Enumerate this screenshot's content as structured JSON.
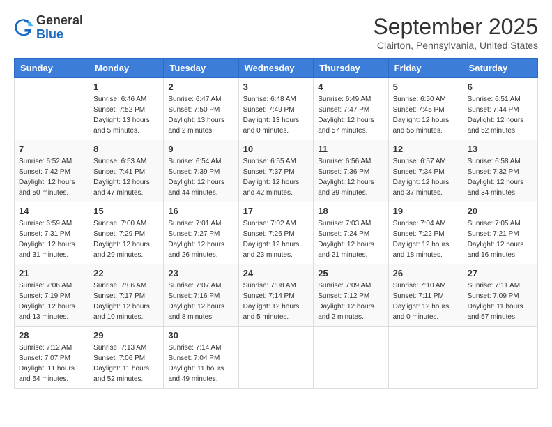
{
  "header": {
    "logo": {
      "general": "General",
      "blue": "Blue"
    },
    "title": "September 2025",
    "location": "Clairton, Pennsylvania, United States"
  },
  "days_of_week": [
    "Sunday",
    "Monday",
    "Tuesday",
    "Wednesday",
    "Thursday",
    "Friday",
    "Saturday"
  ],
  "weeks": [
    [
      {
        "day": "",
        "info": ""
      },
      {
        "day": "1",
        "info": "Sunrise: 6:46 AM\nSunset: 7:52 PM\nDaylight: 13 hours\nand 5 minutes."
      },
      {
        "day": "2",
        "info": "Sunrise: 6:47 AM\nSunset: 7:50 PM\nDaylight: 13 hours\nand 2 minutes."
      },
      {
        "day": "3",
        "info": "Sunrise: 6:48 AM\nSunset: 7:49 PM\nDaylight: 13 hours\nand 0 minutes."
      },
      {
        "day": "4",
        "info": "Sunrise: 6:49 AM\nSunset: 7:47 PM\nDaylight: 12 hours\nand 57 minutes."
      },
      {
        "day": "5",
        "info": "Sunrise: 6:50 AM\nSunset: 7:45 PM\nDaylight: 12 hours\nand 55 minutes."
      },
      {
        "day": "6",
        "info": "Sunrise: 6:51 AM\nSunset: 7:44 PM\nDaylight: 12 hours\nand 52 minutes."
      }
    ],
    [
      {
        "day": "7",
        "info": "Sunrise: 6:52 AM\nSunset: 7:42 PM\nDaylight: 12 hours\nand 50 minutes."
      },
      {
        "day": "8",
        "info": "Sunrise: 6:53 AM\nSunset: 7:41 PM\nDaylight: 12 hours\nand 47 minutes."
      },
      {
        "day": "9",
        "info": "Sunrise: 6:54 AM\nSunset: 7:39 PM\nDaylight: 12 hours\nand 44 minutes."
      },
      {
        "day": "10",
        "info": "Sunrise: 6:55 AM\nSunset: 7:37 PM\nDaylight: 12 hours\nand 42 minutes."
      },
      {
        "day": "11",
        "info": "Sunrise: 6:56 AM\nSunset: 7:36 PM\nDaylight: 12 hours\nand 39 minutes."
      },
      {
        "day": "12",
        "info": "Sunrise: 6:57 AM\nSunset: 7:34 PM\nDaylight: 12 hours\nand 37 minutes."
      },
      {
        "day": "13",
        "info": "Sunrise: 6:58 AM\nSunset: 7:32 PM\nDaylight: 12 hours\nand 34 minutes."
      }
    ],
    [
      {
        "day": "14",
        "info": "Sunrise: 6:59 AM\nSunset: 7:31 PM\nDaylight: 12 hours\nand 31 minutes."
      },
      {
        "day": "15",
        "info": "Sunrise: 7:00 AM\nSunset: 7:29 PM\nDaylight: 12 hours\nand 29 minutes."
      },
      {
        "day": "16",
        "info": "Sunrise: 7:01 AM\nSunset: 7:27 PM\nDaylight: 12 hours\nand 26 minutes."
      },
      {
        "day": "17",
        "info": "Sunrise: 7:02 AM\nSunset: 7:26 PM\nDaylight: 12 hours\nand 23 minutes."
      },
      {
        "day": "18",
        "info": "Sunrise: 7:03 AM\nSunset: 7:24 PM\nDaylight: 12 hours\nand 21 minutes."
      },
      {
        "day": "19",
        "info": "Sunrise: 7:04 AM\nSunset: 7:22 PM\nDaylight: 12 hours\nand 18 minutes."
      },
      {
        "day": "20",
        "info": "Sunrise: 7:05 AM\nSunset: 7:21 PM\nDaylight: 12 hours\nand 16 minutes."
      }
    ],
    [
      {
        "day": "21",
        "info": "Sunrise: 7:06 AM\nSunset: 7:19 PM\nDaylight: 12 hours\nand 13 minutes."
      },
      {
        "day": "22",
        "info": "Sunrise: 7:06 AM\nSunset: 7:17 PM\nDaylight: 12 hours\nand 10 minutes."
      },
      {
        "day": "23",
        "info": "Sunrise: 7:07 AM\nSunset: 7:16 PM\nDaylight: 12 hours\nand 8 minutes."
      },
      {
        "day": "24",
        "info": "Sunrise: 7:08 AM\nSunset: 7:14 PM\nDaylight: 12 hours\nand 5 minutes."
      },
      {
        "day": "25",
        "info": "Sunrise: 7:09 AM\nSunset: 7:12 PM\nDaylight: 12 hours\nand 2 minutes."
      },
      {
        "day": "26",
        "info": "Sunrise: 7:10 AM\nSunset: 7:11 PM\nDaylight: 12 hours\nand 0 minutes."
      },
      {
        "day": "27",
        "info": "Sunrise: 7:11 AM\nSunset: 7:09 PM\nDaylight: 11 hours\nand 57 minutes."
      }
    ],
    [
      {
        "day": "28",
        "info": "Sunrise: 7:12 AM\nSunset: 7:07 PM\nDaylight: 11 hours\nand 54 minutes."
      },
      {
        "day": "29",
        "info": "Sunrise: 7:13 AM\nSunset: 7:06 PM\nDaylight: 11 hours\nand 52 minutes."
      },
      {
        "day": "30",
        "info": "Sunrise: 7:14 AM\nSunset: 7:04 PM\nDaylight: 11 hours\nand 49 minutes."
      },
      {
        "day": "",
        "info": ""
      },
      {
        "day": "",
        "info": ""
      },
      {
        "day": "",
        "info": ""
      },
      {
        "day": "",
        "info": ""
      }
    ]
  ]
}
